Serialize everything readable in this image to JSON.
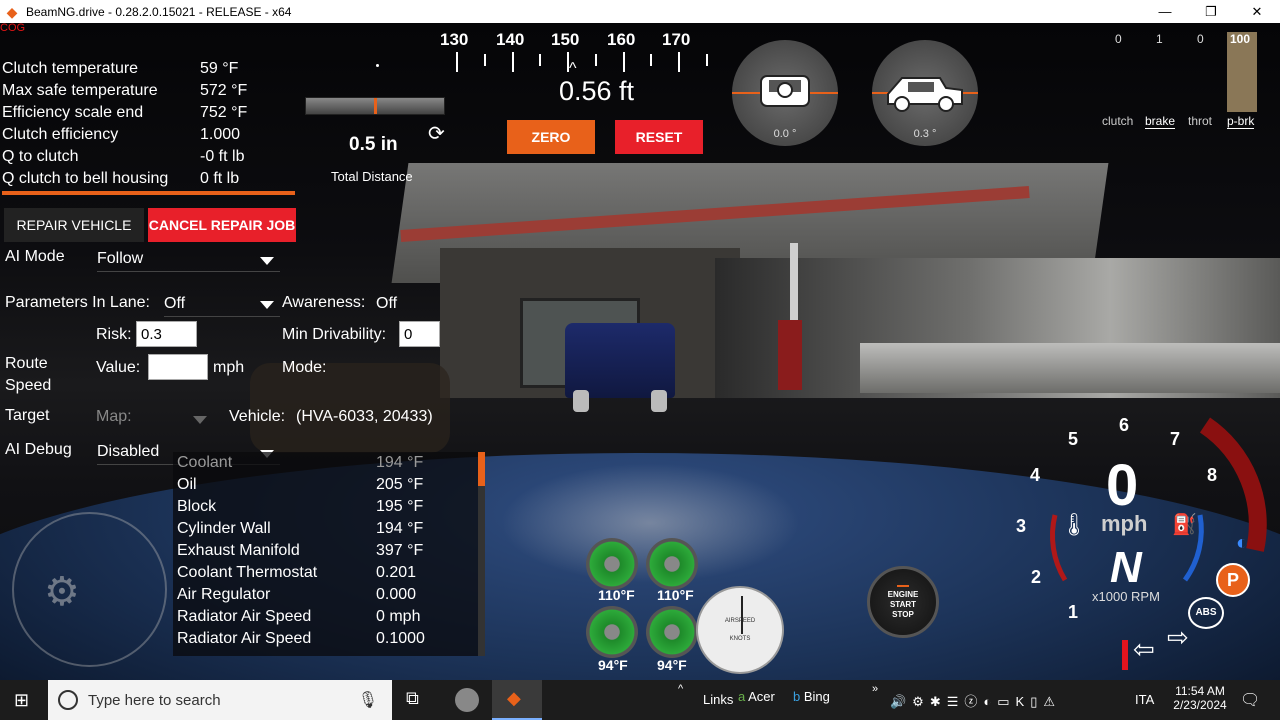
{
  "window": {
    "title": "BeamNG.drive - 0.28.2.0.15021 - RELEASE - x64",
    "app_icon": "beamng-icon"
  },
  "debug": {
    "cog_label": "COG",
    "rows": [
      {
        "label": "Clutch temperature",
        "value": "59 °F"
      },
      {
        "label": "Max safe temperature",
        "value": "572 °F"
      },
      {
        "label": "Efficiency scale end",
        "value": "752 °F"
      },
      {
        "label": "Clutch efficiency",
        "value": "1.000"
      },
      {
        "label": "Q to clutch",
        "value": "-0 ft lb"
      },
      {
        "label": "Q clutch to bell housing",
        "value": "0 ft lb"
      }
    ]
  },
  "repair": {
    "repair_label": "REPAIR VEHICLE",
    "cancel_label": "CANCEL REPAIR JOB"
  },
  "ai": {
    "mode_label": "AI Mode",
    "mode_value": "Follow",
    "lane_label": "Parameters In Lane:",
    "lane_value": "Off",
    "awareness_label": "Awareness:",
    "awareness_value": "Off",
    "risk_label": "Risk:",
    "risk_value": "0.3",
    "drivability_label": "Min Drivability:",
    "drivability_value": "0",
    "route_label": "Route",
    "speed_label": "Speed",
    "value_label": "Value:",
    "speed_value": "",
    "unit": "mph",
    "mode2_label": "Mode:",
    "target_label": "Target",
    "map_label": "Map:",
    "vehicle_label": "Vehicle:",
    "vehicle_value": "(HVA-6033, 20433)",
    "debug_label": "AI Debug",
    "debug_value": "Disabled"
  },
  "temps": [
    {
      "label": "Coolant",
      "value": "194 °F"
    },
    {
      "label": "Oil",
      "value": "205 °F"
    },
    {
      "label": "Block",
      "value": "195 °F"
    },
    {
      "label": "Cylinder Wall",
      "value": "194 °F"
    },
    {
      "label": "Exhaust Manifold",
      "value": "397 °F"
    },
    {
      "label": "Coolant Thermostat",
      "value": "0.201"
    },
    {
      "label": "Air Regulator",
      "value": "0.000"
    },
    {
      "label": "Radiator Air Speed",
      "value": "0 mph"
    },
    {
      "label": "Radiator Air Speed",
      "value": "0.1000"
    }
  ],
  "distance": {
    "ruler": [
      "130",
      "140",
      "150",
      "160",
      "170"
    ],
    "pointer": "^",
    "measure": "0.56 ft",
    "small_value": "0.5 in",
    "total_label": "Total Distance",
    "zero_label": "ZERO",
    "reset_label": "RESET"
  },
  "tilt": {
    "roll": "0.0 °",
    "pitch": "0.3 °"
  },
  "pedals": {
    "values": [
      "0",
      "1",
      "0",
      "100"
    ],
    "labels": [
      "clutch",
      "brake",
      "throt",
      "p-brk"
    ],
    "pbrk_fraction": 1.0
  },
  "brakes": {
    "front_left": "110°F",
    "front_right": "110°F",
    "rear_left": "94°F",
    "rear_right": "94°F"
  },
  "airspeed": {
    "label": "AIRSPEED",
    "unit": "KNOTS"
  },
  "engine_button": {
    "line1": "ENGINE",
    "line2": "START",
    "line3": "STOP"
  },
  "cluster": {
    "gear_marks": [
      "1",
      "2",
      "3",
      "4",
      "5",
      "6",
      "7",
      "8"
    ],
    "speed": "0",
    "speed_unit": "mph",
    "gear": "N",
    "rpm_label": "x1000 RPM",
    "abs_label": "ABS",
    "park_label": "P"
  },
  "taskbar": {
    "search_placeholder": "Type here to search",
    "links_label": "Links",
    "acer_label": "Acer",
    "bing_label": "Bing",
    "language": "ITA",
    "time": "11:54 AM",
    "date": "2/23/2024"
  }
}
